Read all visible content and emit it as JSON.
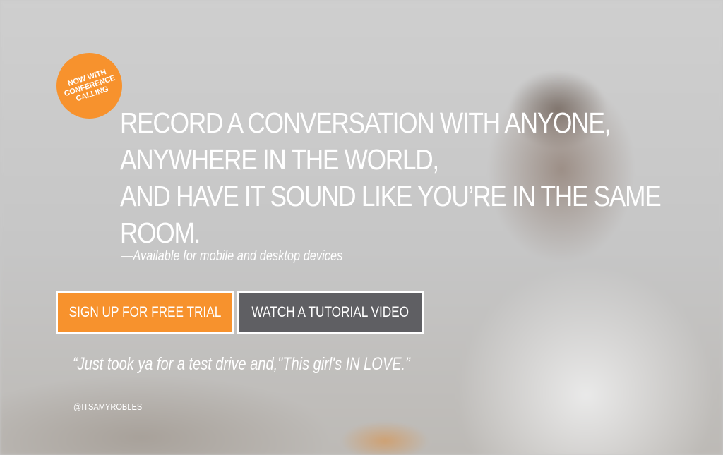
{
  "badge": {
    "lines": [
      "NOW WITH",
      "CONFERENCE",
      "CALLING"
    ]
  },
  "hero": {
    "headline_lines": [
      "RECORD A CONVERSATION WITH ANYONE,",
      "ANYWHERE IN THE WORLD,",
      "AND HAVE IT SOUND LIKE YOU’RE IN THE SAME",
      "ROOM."
    ],
    "subline": "—Available for mobile and desktop devices"
  },
  "buttons": {
    "signup_label": "SIGN UP FOR FREE TRIAL",
    "tutorial_label": "WATCH A TUTORIAL VIDEO"
  },
  "testimonial": {
    "quote": "“Just took ya for a test drive and,\"This girl's IN LOVE.”",
    "handle": "@ITSAMYROBLES"
  },
  "colors": {
    "accent": "#f7922d",
    "secondary_button": "#5f5f63",
    "text": "#ffffff"
  }
}
